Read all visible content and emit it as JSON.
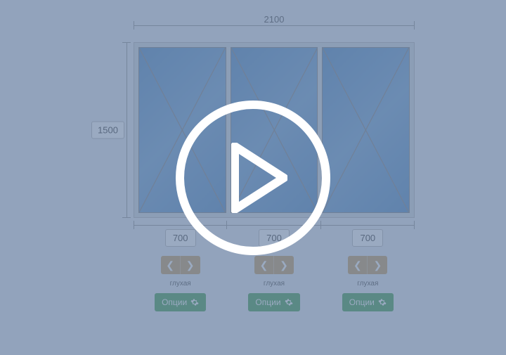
{
  "dimensions": {
    "total_width": "2100",
    "height": "1500",
    "pane_widths": [
      "700",
      "700",
      "700"
    ]
  },
  "panes": [
    {
      "type_label": "глухая",
      "options_label": "Опции"
    },
    {
      "type_label": "глухая",
      "options_label": "Опции"
    },
    {
      "type_label": "глухая",
      "options_label": "Опции"
    }
  ]
}
